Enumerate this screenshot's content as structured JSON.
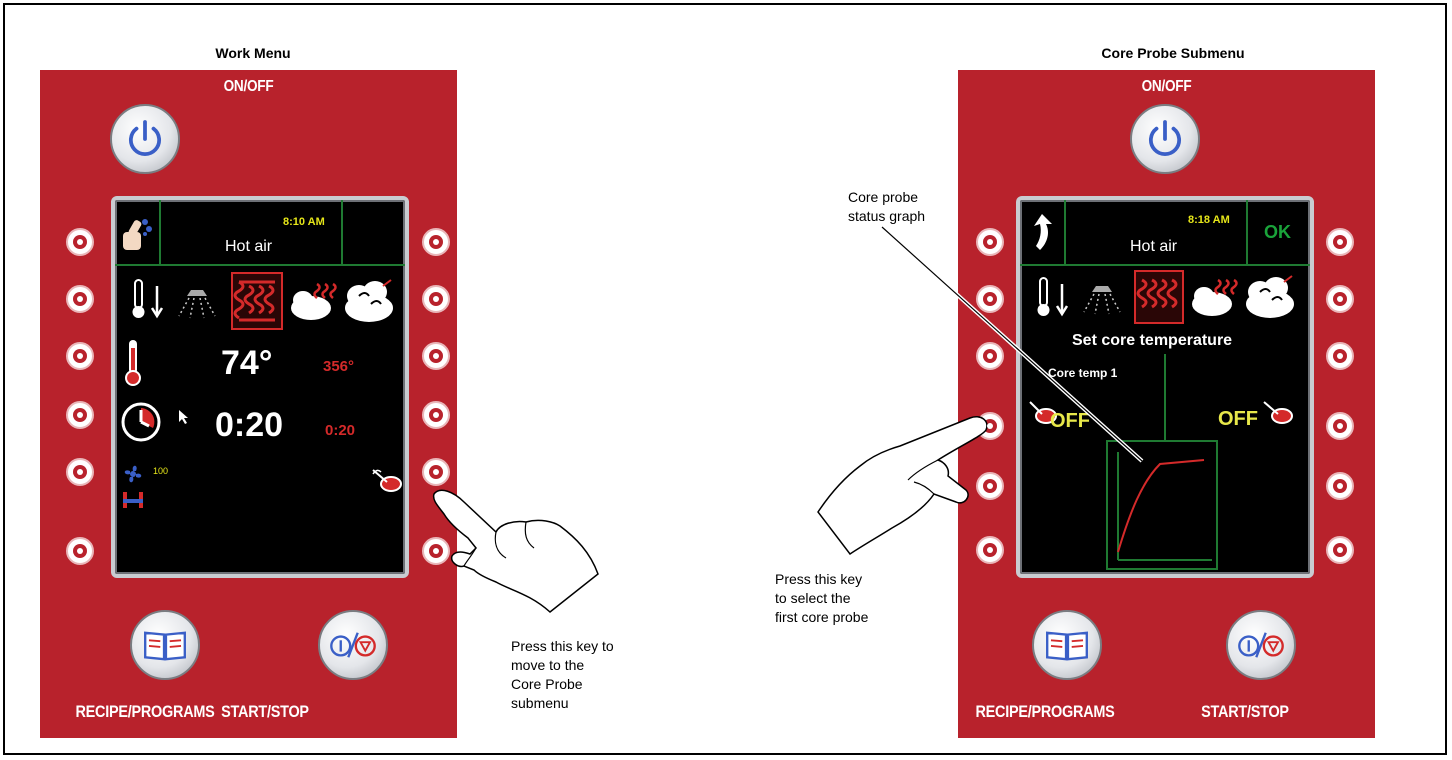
{
  "left": {
    "title": "Work Menu",
    "on_off": "ON/OFF",
    "time": "8:10 AM",
    "mode": "Hot air",
    "temp_value": "74°",
    "temp_setpoint": "356°",
    "time_value": "0:20",
    "time_setpoint": "0:20",
    "fan_value": "100",
    "recipe_label": "RECIPE/PROGRAMS",
    "start_label": "START/STOP",
    "annotation": "Press this key to move to the Core Probe submenu",
    "annotation_lines": [
      "Press this key to",
      "move to the",
      "Core Probe",
      "submenu"
    ]
  },
  "right": {
    "title": "Core Probe Submenu",
    "on_off": "ON/OFF",
    "time": "8:18 AM",
    "ok": "OK",
    "mode": "Hot air",
    "heading": "Set core temperature",
    "core_label": "Core temp 1",
    "off_left": "OFF",
    "off_right": "OFF",
    "recipe_label": "RECIPE/PROGRAMS",
    "start_label": "START/STOP",
    "graph_annotation_lines": [
      "Core probe",
      "status graph"
    ],
    "annotation_lines": [
      "Press this key",
      "to select the",
      "first core probe"
    ]
  },
  "colors": {
    "panel_red": "#b8222c",
    "status_green": "#1f7a32",
    "time_yellow": "#e6e619",
    "setpoint_red": "#d42a2a",
    "ok_green": "#1aa33a",
    "off_yellow": "#e8e84a"
  }
}
